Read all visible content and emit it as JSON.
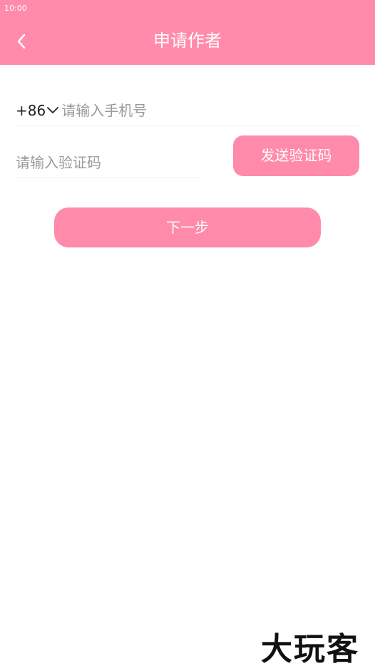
{
  "status_bar": {
    "time": "10:00"
  },
  "header": {
    "title": "申请作者",
    "back_icon": "chevron-left-icon"
  },
  "form": {
    "country_code": "+86",
    "phone_placeholder": "请输入手机号",
    "code_placeholder": "请输入验证码",
    "send_code_label": "发送验证码",
    "next_label": "下一步"
  },
  "watermark": {
    "text": "大玩客"
  },
  "colors": {
    "accent": "#ff8aa9"
  }
}
